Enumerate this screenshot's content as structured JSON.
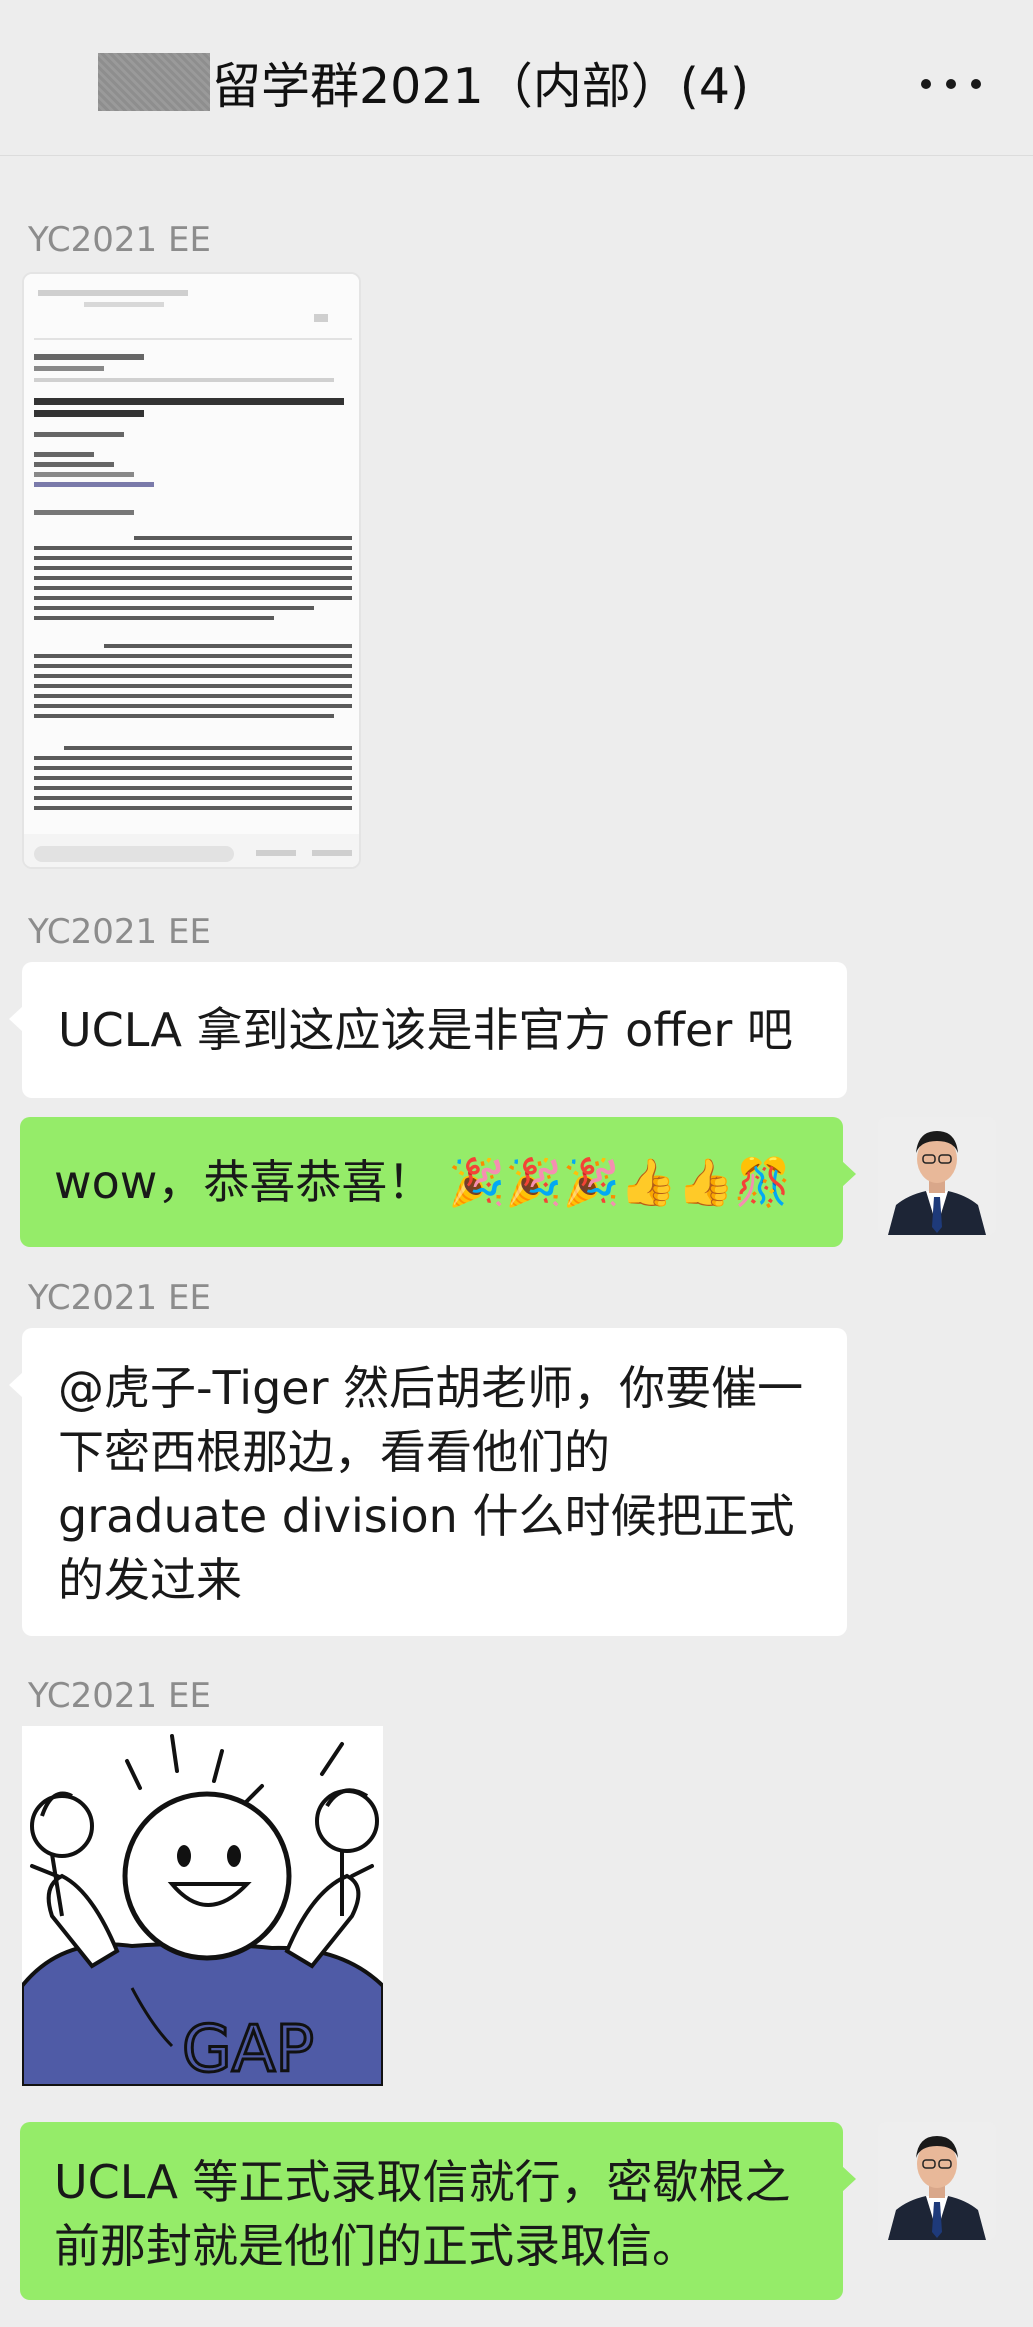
{
  "header": {
    "title": "留学群2021（内部）(4)",
    "more_icon": "more-icon"
  },
  "messages": [
    {
      "sender": "YC2021 EE",
      "type": "image",
      "image_kind": "email-document-screenshot"
    },
    {
      "sender": "YC2021 EE",
      "type": "text",
      "text": "UCLA 拿到这应该是非官方 offer 吧"
    },
    {
      "type": "text",
      "outgoing": true,
      "text": "wow，恭喜恭喜！ 🎉🎉🎉👍👍🎊"
    },
    {
      "sender": "YC2021 EE",
      "type": "text",
      "text": "@虎子-Tiger 然后胡老师，你要催一下密西根那边，看看他们的 graduate division 什么时候把正式的发过来"
    },
    {
      "sender": "YC2021 EE",
      "type": "sticker",
      "sticker_text": "GAP"
    },
    {
      "type": "text",
      "outgoing": true,
      "text": "UCLA 等正式录取信就行，密歇根之前那封就是他们的正式录取信。"
    }
  ],
  "colors": {
    "background": "#ededed",
    "incoming_bubble": "#ffffff",
    "outgoing_bubble": "#95ec69",
    "sender_name": "#8c8c8c"
  }
}
